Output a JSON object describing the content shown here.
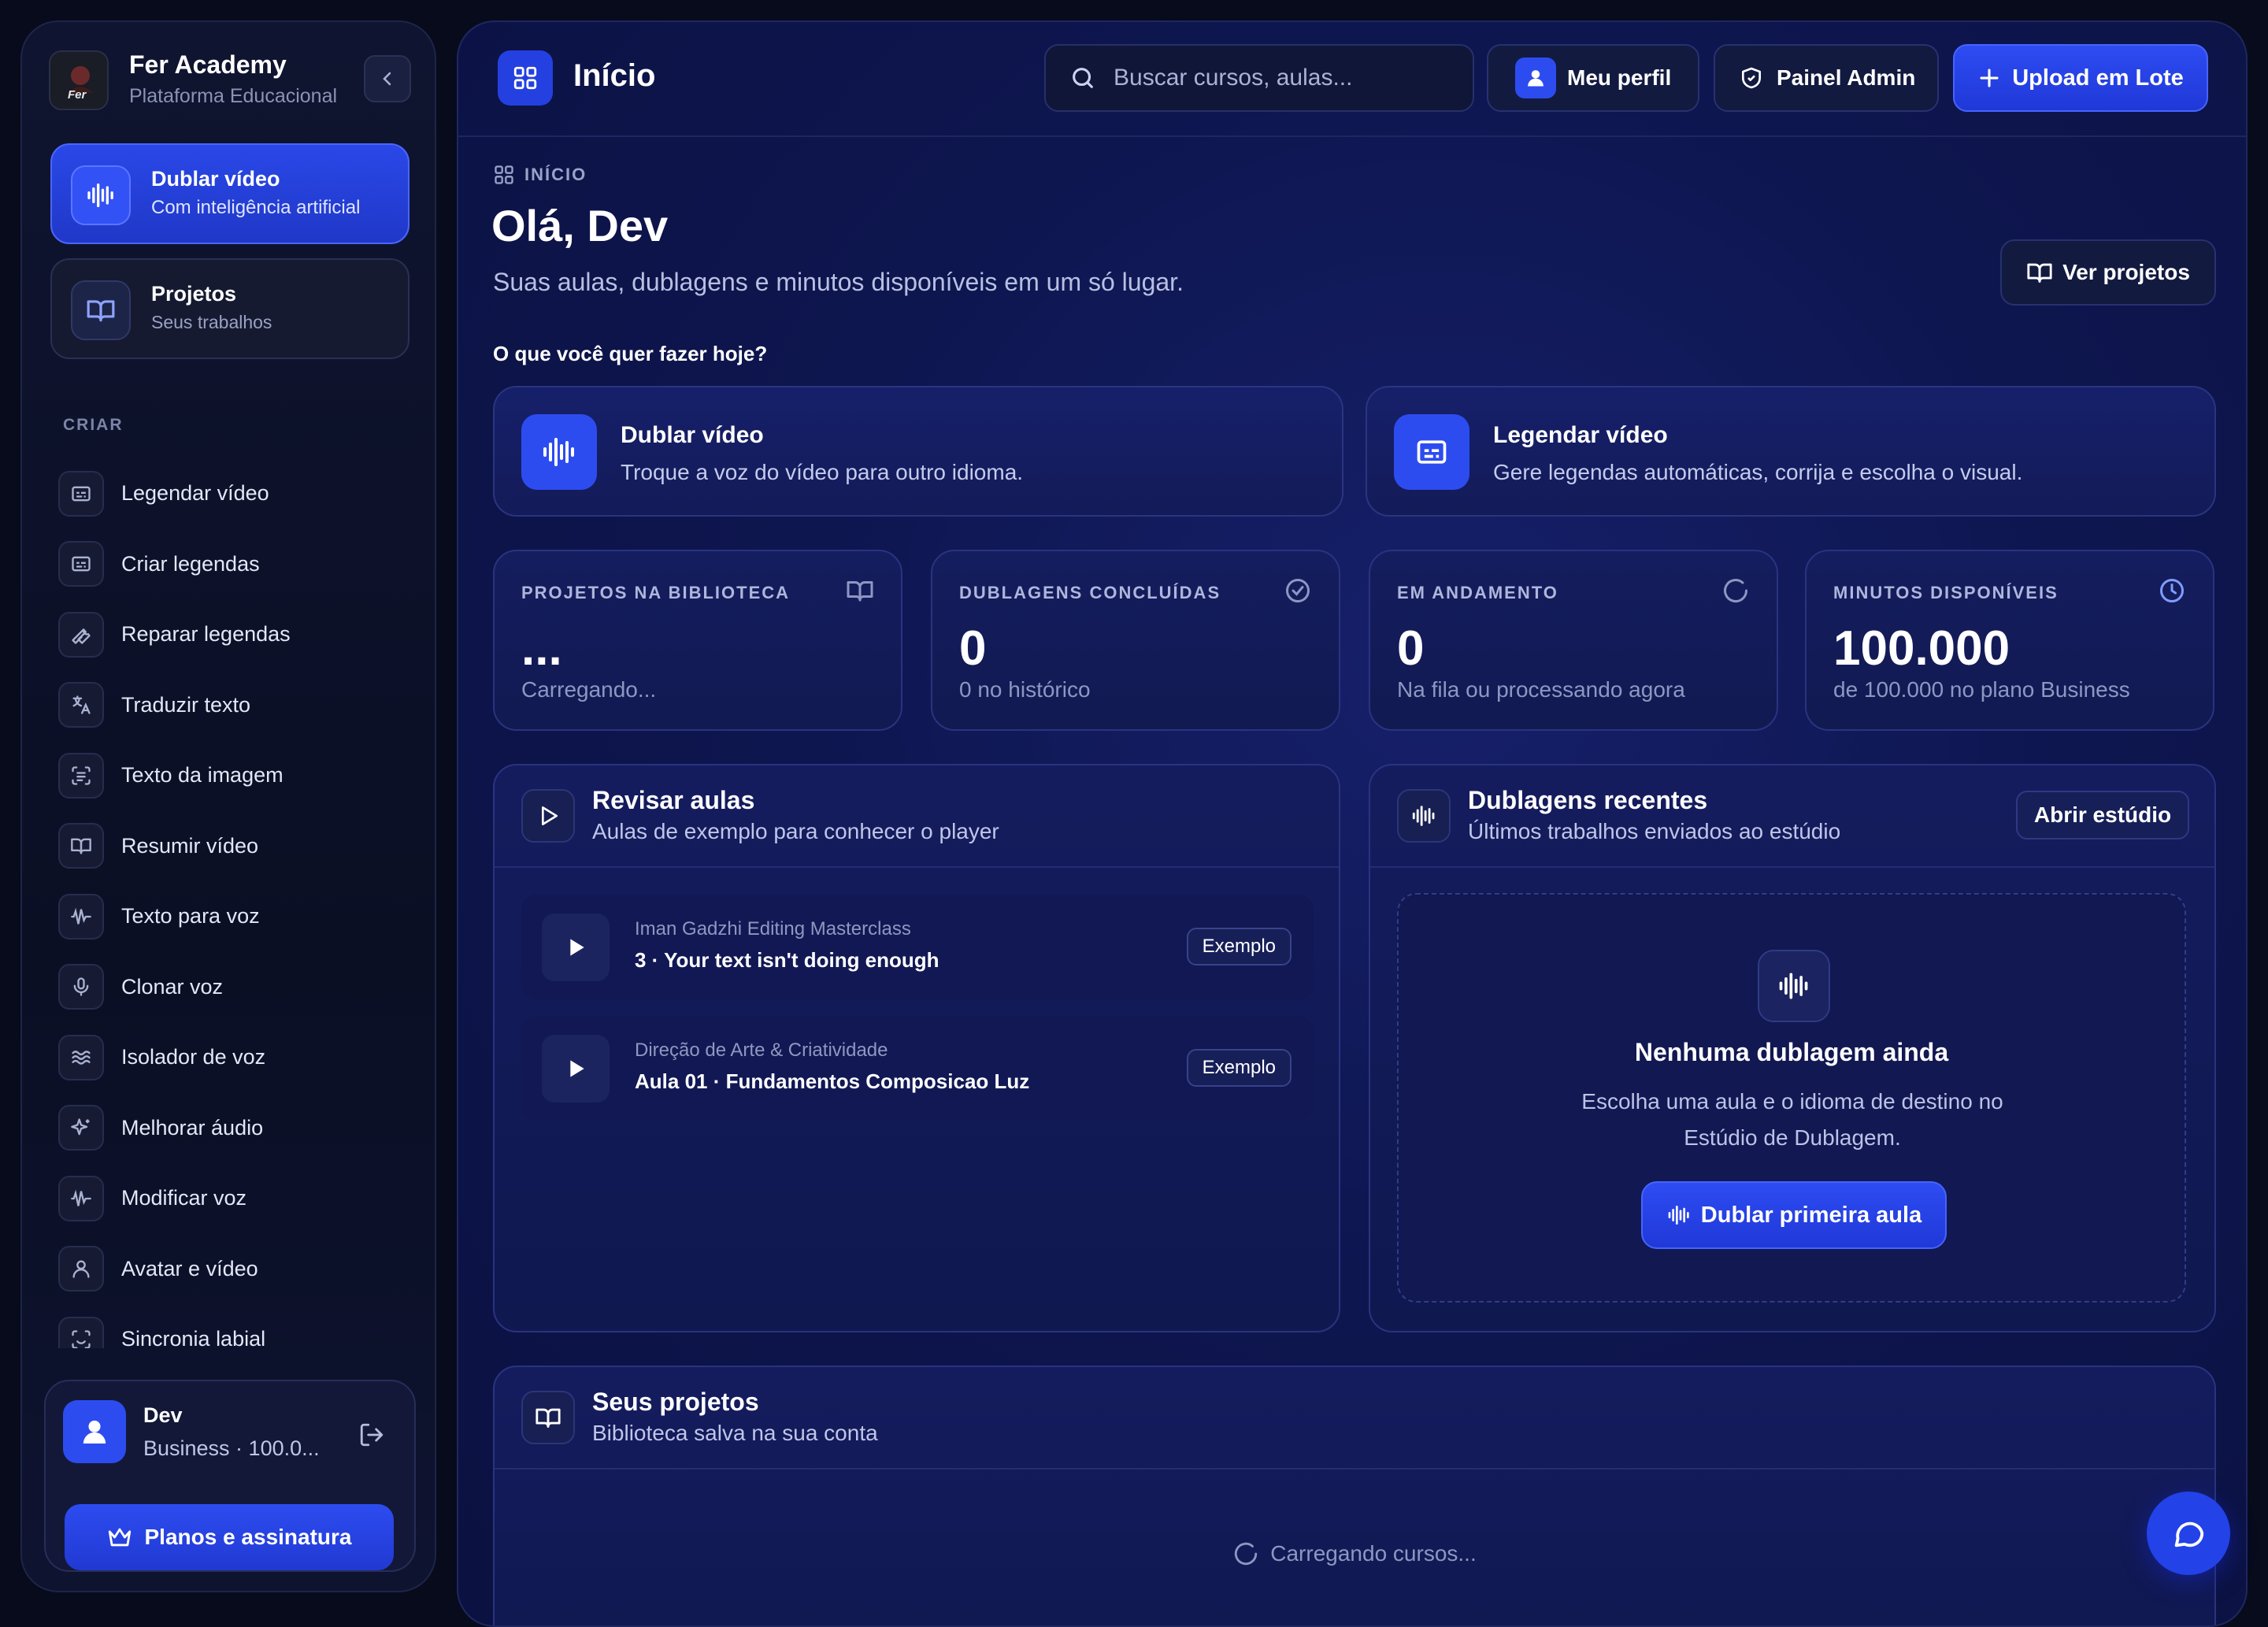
{
  "brand": {
    "name": "Fer Academy",
    "subtitle": "Plataforma Educacional",
    "logo_text": "Fer"
  },
  "sidebar": {
    "primary_actions": [
      {
        "title": "Dublar vídeo",
        "subtitle": "Com inteligência artificial",
        "icon": "audio-wave-icon"
      },
      {
        "title": "Projetos",
        "subtitle": "Seus trabalhos",
        "icon": "book-icon"
      }
    ],
    "section_label": "CRIAR",
    "items": [
      {
        "label": "Legendar vídeo",
        "icon": "subtitles-icon"
      },
      {
        "label": "Criar legendas",
        "icon": "subtitles-icon"
      },
      {
        "label": "Reparar legendas",
        "icon": "wrench-icon"
      },
      {
        "label": "Traduzir texto",
        "icon": "translate-icon"
      },
      {
        "label": "Texto da imagem",
        "icon": "scan-text-icon"
      },
      {
        "label": "Resumir vídeo",
        "icon": "book-icon"
      },
      {
        "label": "Texto para voz",
        "icon": "audio-lines-icon"
      },
      {
        "label": "Clonar voz",
        "icon": "microphone-icon"
      },
      {
        "label": "Isolador de voz",
        "icon": "waves-icon"
      },
      {
        "label": "Melhorar áudio",
        "icon": "sparkles-icon"
      },
      {
        "label": "Modificar voz",
        "icon": "audio-lines-icon"
      },
      {
        "label": "Avatar e vídeo",
        "icon": "user-icon"
      },
      {
        "label": "Sincronia labial",
        "icon": "scan-face-icon"
      }
    ],
    "user": {
      "name": "Dev",
      "plan": "Business · 100.0...",
      "plans_button": "Planos e assinatura"
    }
  },
  "topbar": {
    "title": "Início",
    "search_placeholder": "Buscar cursos, aulas...",
    "profile_button": "Meu perfil",
    "admin_button": "Painel Admin",
    "upload_button": "Upload em Lote"
  },
  "header": {
    "breadcrumb": "INÍCIO",
    "greeting": "Olá, Dev",
    "subtitle": "Suas aulas, dublagens e minutos disponíveis em um só lugar.",
    "view_projects_button": "Ver projetos",
    "question": "O que você quer fazer hoje?"
  },
  "actions": [
    {
      "title": "Dublar vídeo",
      "subtitle": "Troque a voz do vídeo para outro idioma.",
      "icon": "audio-wave-icon"
    },
    {
      "title": "Legendar vídeo",
      "subtitle": "Gere legendas automáticas, corrija e escolha o visual.",
      "icon": "subtitles-icon"
    }
  ],
  "stats": [
    {
      "label": "PROJETOS NA BIBLIOTECA",
      "value": "...",
      "sub": "Carregando...",
      "icon": "book-icon"
    },
    {
      "label": "DUBLAGENS CONCLUÍDAS",
      "value": "0",
      "sub": "0 no histórico",
      "icon": "check-circle-icon"
    },
    {
      "label": "EM ANDAMENTO",
      "value": "0",
      "sub": "Na fila ou processando agora",
      "icon": "refresh-icon"
    },
    {
      "label": "MINUTOS DISPONÍVEIS",
      "value": "100.000",
      "sub": "de 100.000 no plano Business",
      "icon": "clock-icon"
    }
  ],
  "review": {
    "title": "Revisar aulas",
    "subtitle": "Aulas de exemplo para conhecer o player",
    "lessons": [
      {
        "course": "Iman Gadzhi Editing Masterclass",
        "title": "3 · Your text isn't doing enough",
        "badge": "Exemplo"
      },
      {
        "course": "Direção de Arte & Criatividade",
        "title": "Aula 01 · Fundamentos Composicao Luz",
        "badge": "Exemplo"
      }
    ]
  },
  "recent": {
    "title": "Dublagens recentes",
    "subtitle": "Últimos trabalhos enviados ao estúdio",
    "open_button": "Abrir estúdio",
    "empty_title": "Nenhuma dublagem ainda",
    "empty_text": "Escolha uma aula e o idioma de destino no Estúdio de Dublagem.",
    "empty_button": "Dublar primeira aula"
  },
  "projects": {
    "title": "Seus projetos",
    "subtitle": "Biblioteca salva na sua conta",
    "loading": "Carregando cursos..."
  },
  "colors": {
    "accent": "#2d4cf0",
    "background": "#0b1140",
    "sidebar": "#0d1128"
  }
}
